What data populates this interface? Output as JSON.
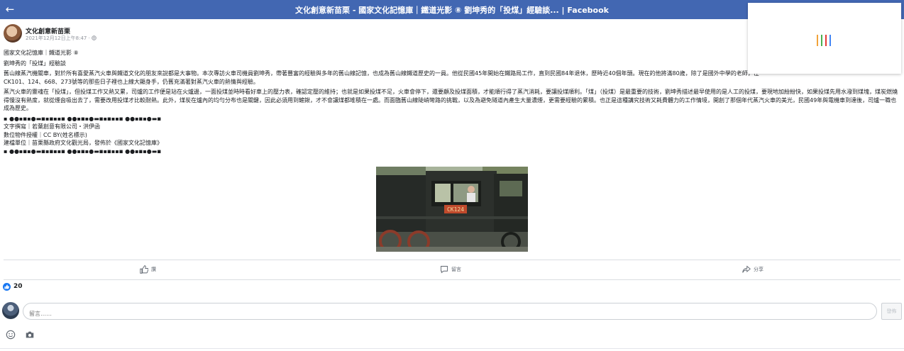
{
  "topbar": {
    "title": "文化創意新苗栗 - 國家文化記憶庫｜鐵道光影 ⑧ 劉坤秀的「投煤」經驗談... | Facebook",
    "back_icon": "arrow-left-icon"
  },
  "loader": {
    "colors": [
      "#f2a33a",
      "#4caf50",
      "#e53935",
      "#4285f4"
    ]
  },
  "post": {
    "page_name": "文化創意新苗栗",
    "timestamp": "2021年12月12日上午8:47 · ",
    "privacy_icon": "globe-icon",
    "body": [
      "國家文化記憶庫｜鐵道光影 ⑧",
      "劉坤秀的「投煤」經驗談",
      "舊山線蒸汽機關車，對於所有喜愛蒸汽火車與鐵道文化的朋友來說都是大事物。本次專訪火車司機員劉坤秀，帶著豐富的經驗與多年的舊山線記憶，也成為舊山線鐵道歷史的一員。他從民國45年開始在鐵路局工作，直到民國84年退休，歷時近40個年頭。現在的他將滿80歲，除了是國外中學的老師，在",
      "CK101、124、668、273號等的那些日子裡也上線大顯身手，仍舊充滿著對蒸汽火車的熱情與經驗。",
      "蒸汽火車的靈魂在「投煤」，但投煤工作又熱又累，司爐的工作便是站在火爐邊，一面投煤並時時看好車上的壓力表，確認定壓的維持；也就是如果投煤不足，火車會停下，還要顧及投煤面積，才能順行得了蒸汽消耗，要讓投煤順利。「煤」（投煤）是最重要的技術，劉坤秀描述最早使用的是人工的投煤，要現地加紛紛快，如果投煤先用水潑到煤塊，煤炭燃燒得慢沒有熱度，就從煙囪吸出去了，需要改用投煤才比較耐熱。此外，煤炭在爐內的均勻分布也是關鍵，因此必須用到鏟鍬，才不會讓煤都堆積在一處。而面臨舊山線陡峭彎路的挑戰，以及為避免隧道內產生大量濃煙，更需要經驗的累積。也正是這種講究技術又耗費體力的工作情境，開創了那個年代蒸汽火車的美光，民國49年與電機車到達後，司爐一職也成為歷史。",
      "▪ ●●▪◾▪●▬◾▪◾▪▪◾ ●●▪◾▪●▬◾▪◾▪▪◾ ●●▪◾▪●▬◾",
      "文字撰寫｜若葉創意有限公司・洪伊函",
      "數位物件授權｜CC BY(姓名標示)",
      "建檔單位｜苗栗縣政府文化觀光局，發佈於《國家文化記憶庫》",
      "▪ ●●▪◾▪●▬◾▪◾▪▪◾ ●●▪◾▪●▬◾▪◾▪▪◾ ●●▪◾▪●▬◾"
    ],
    "photo": {
      "plate": "CK124"
    }
  },
  "actions": {
    "like": {
      "label": "讚",
      "icon": "thumbs-up-icon"
    },
    "comment": {
      "label": "留言",
      "icon": "comment-icon"
    },
    "share": {
      "label": "分享",
      "icon": "share-icon"
    }
  },
  "reactions": {
    "count": "20",
    "icon": "like-reaction-icon"
  },
  "comment": {
    "placeholder": "留言……",
    "submit_label": "發佈",
    "emoji_icon": "emoji-icon",
    "camera_icon": "camera-icon"
  }
}
